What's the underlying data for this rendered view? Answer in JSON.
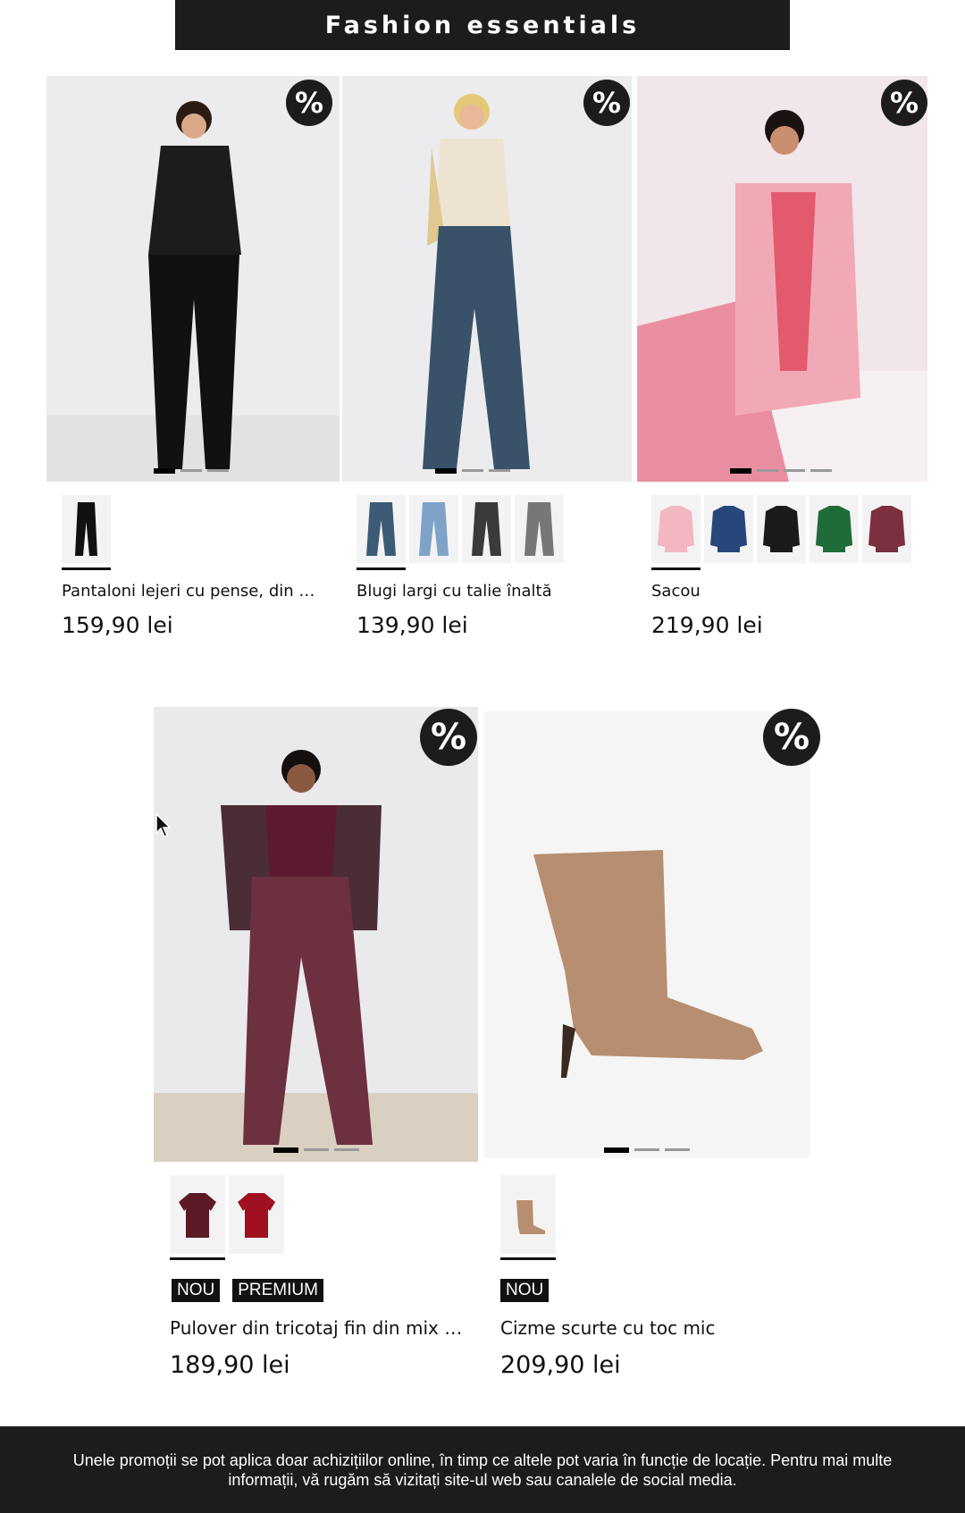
{
  "header": {
    "title": "Fashion essentials"
  },
  "discount_symbol": "%",
  "products": [
    {
      "name": "Pantaloni lejeri cu pense, din mat…",
      "price": "159,90 lei",
      "tags": [],
      "swatch_colors": [
        "#111111"
      ],
      "image_dots": 3
    },
    {
      "name": "Blugi largi cu talie înaltă",
      "price": "139,90 lei",
      "tags": [],
      "swatch_colors": [
        "#3d5a76",
        "#7fa3c8",
        "#3a3a3a",
        "#777777"
      ],
      "image_dots": 3
    },
    {
      "name": "Sacou",
      "price": "219,90 lei",
      "tags": [],
      "swatch_colors": [
        "#f4b6c2",
        "#27477a",
        "#1a1a1a",
        "#1f6b3a",
        "#7b2f3f"
      ],
      "image_dots": 4
    },
    {
      "name": "Pulover din tricotaj fin din mix mo…",
      "price": "189,90 lei",
      "tags": [
        "NOU",
        "PREMIUM"
      ],
      "swatch_colors": [
        "#5c1a26",
        "#a01020"
      ],
      "image_dots": 3
    },
    {
      "name": "Cizme scurte cu toc mic",
      "price": "209,90 lei",
      "tags": [
        "NOU"
      ],
      "swatch_colors": [
        "#b78e70"
      ],
      "image_dots": 3
    }
  ],
  "footer": {
    "text": "Unele promoții se pot aplica doar achizițiilor online, în timp ce altele pot varia în funcție de locație. Pentru mai multe informații, vă rugăm să vizitați site-ul web sau canalele de social media."
  }
}
